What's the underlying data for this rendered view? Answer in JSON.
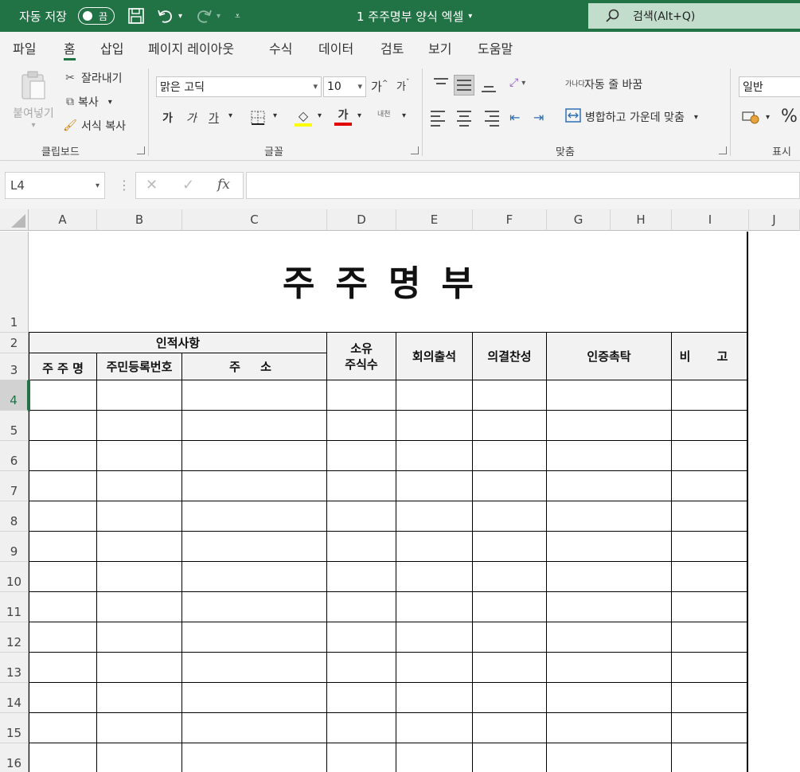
{
  "titlebar": {
    "autosave_label": "자동 저장",
    "autosave_state": "끔",
    "doc_title": "1 주주명부 양식 엑셀",
    "search_label": "검색(Alt+Q)",
    "bg_color": "#217346"
  },
  "menu": {
    "tabs": [
      "파일",
      "홈",
      "삽입",
      "페이지 레이아웃",
      "수식",
      "데이터",
      "검토",
      "보기",
      "도움말"
    ],
    "active": "홈"
  },
  "ribbon": {
    "clipboard": {
      "paste": "붙여넣기",
      "cut": "잘라내기",
      "copy": "복사",
      "format_painter": "서식 복사",
      "group_label": "클립보드"
    },
    "font": {
      "font_name": "맑은 고딕",
      "font_size": "10",
      "grow": "가",
      "shrink": "가",
      "bold": "가",
      "italic": "가",
      "underline": "가",
      "font_color_letter": "가",
      "phonetic": "내천",
      "group_label": "글꼴",
      "fill_color": "#ffff00",
      "font_color": "#e00000"
    },
    "alignment": {
      "wrap_text": "자동 줄 바꿈",
      "merge_center": "병합하고 가운데 맞춤",
      "wrap_icon_text": "가나다",
      "group_label": "맞춤"
    },
    "number": {
      "format": "일반",
      "percent": "%",
      "group_label": "표시"
    }
  },
  "formula_bar": {
    "name_box": "L4",
    "fx": "fx",
    "formula": ""
  },
  "grid": {
    "columns": [
      "A",
      "B",
      "C",
      "D",
      "E",
      "F",
      "G",
      "H",
      "I",
      "J"
    ],
    "rows": [
      "1",
      "2",
      "3",
      "4",
      "5",
      "6",
      "7",
      "8",
      "9",
      "10",
      "11",
      "12",
      "13",
      "14",
      "15",
      "16"
    ],
    "selected_row": "4"
  },
  "sheet": {
    "title": "주주명부",
    "header_group": "인적사항",
    "name": "주 주 명",
    "id_number": "주민등록번호",
    "address": "주 소",
    "shares_line1": "소유",
    "shares_line2": "주식수",
    "attendance": "회의출석",
    "approval": "의결찬성",
    "proxy": "인증촉탁",
    "remarks": "비 고"
  }
}
